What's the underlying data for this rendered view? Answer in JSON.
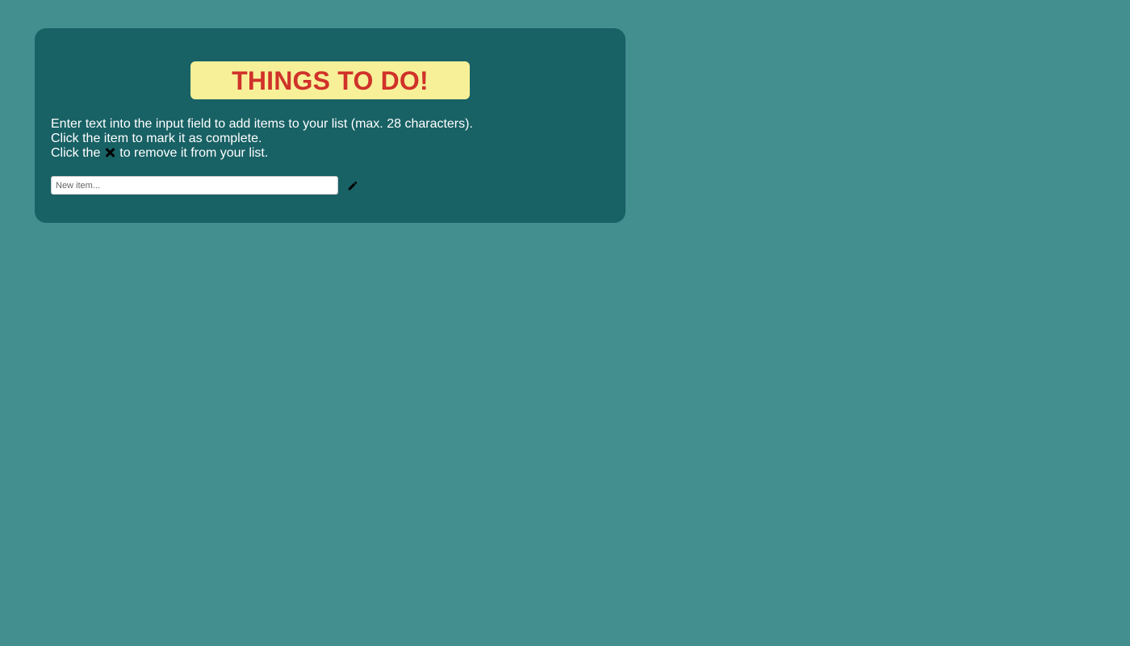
{
  "header": {
    "title": "THINGS TO DO!"
  },
  "instructions": {
    "line1": "Enter text into the input field to add items to your list (max. 28 characters).",
    "line2": "Click the item to mark it as complete.",
    "line3_before": "Click the",
    "line3_icon": "close-icon",
    "line3_after": "to remove it from your list."
  },
  "new_item": {
    "value": "",
    "placeholder": "New item...",
    "max_length": 28,
    "add_icon": "pencil-icon"
  },
  "colors": {
    "page_background": "#438f90",
    "panel_background": "#186165",
    "title_background": "#f7f098",
    "title_text": "#d0322a",
    "body_text": "#ffffff"
  }
}
